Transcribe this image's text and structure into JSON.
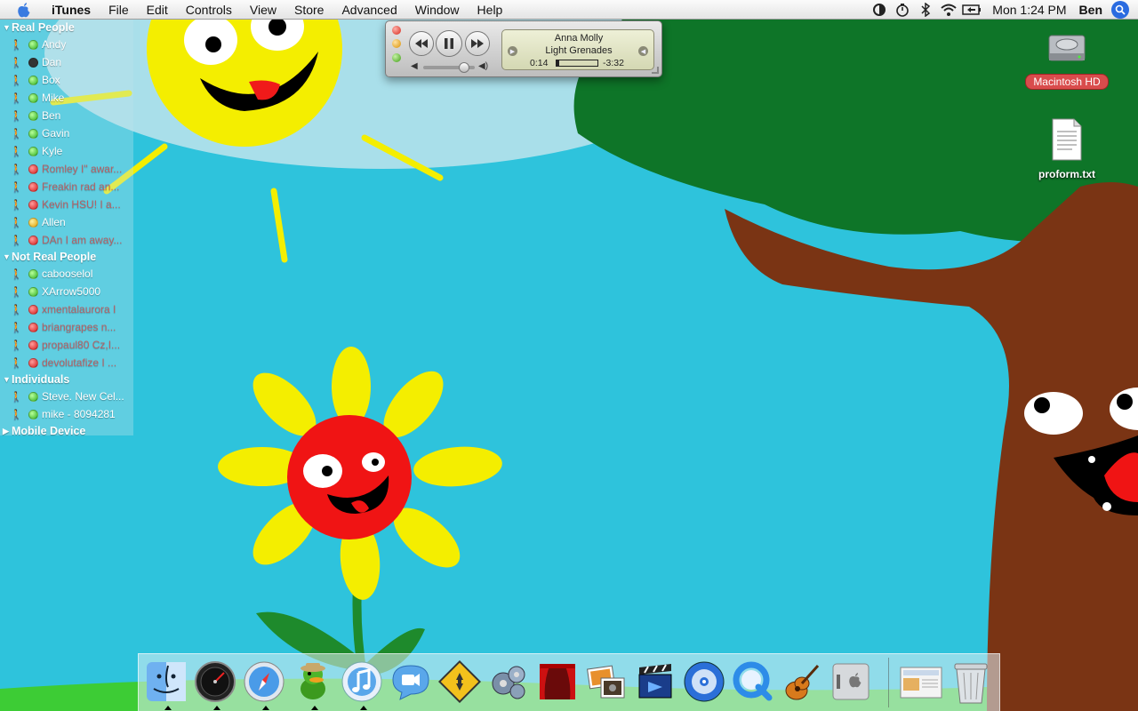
{
  "menubar": {
    "app_name": "iTunes",
    "items": [
      "File",
      "Edit",
      "Controls",
      "View",
      "Store",
      "Advanced",
      "Window",
      "Help"
    ],
    "clock": "Mon 1:24 PM",
    "user": "Ben",
    "tray_icons": [
      "sync-icon",
      "timer-icon",
      "bluetooth-icon",
      "wifi-icon",
      "battery-icon"
    ]
  },
  "buddy_list": {
    "groups": [
      {
        "name": "Real People",
        "expanded": true,
        "buddies": [
          {
            "name": "Andy",
            "status": "green"
          },
          {
            "name": "Dan",
            "status": "idle"
          },
          {
            "name": "Box",
            "status": "green"
          },
          {
            "name": "Mike",
            "status": "green"
          },
          {
            "name": "Ben",
            "status": "green"
          },
          {
            "name": "Gavin",
            "status": "green"
          },
          {
            "name": "Kyle",
            "status": "green"
          },
          {
            "name": "Romley  I\" awar...",
            "status": "red"
          },
          {
            "name": "Freakin rad  an...",
            "status": "red"
          },
          {
            "name": "Kevin HSU! I a...",
            "status": "red"
          },
          {
            "name": "Allen",
            "status": "yellow"
          },
          {
            "name": "DAn  I am away...",
            "status": "red"
          }
        ]
      },
      {
        "name": "Not Real People",
        "expanded": true,
        "buddies": [
          {
            "name": "cabooselol",
            "status": "green"
          },
          {
            "name": "XArrow5000",
            "status": "green"
          },
          {
            "name": "xmentalaurora  I",
            "status": "red"
          },
          {
            "name": "briangrapes  n...",
            "status": "red"
          },
          {
            "name": "propaul80  Cz,I...",
            "status": "red"
          },
          {
            "name": "devolutafize  I ...",
            "status": "red"
          }
        ]
      },
      {
        "name": "Individuals",
        "expanded": true,
        "buddies": [
          {
            "name": "Steve. New Cel...",
            "status": "green"
          },
          {
            "name": "mike - 8094281",
            "status": "green"
          }
        ]
      },
      {
        "name": "Mobile Device",
        "expanded": false,
        "buddies": []
      }
    ]
  },
  "itunes_mini": {
    "song": "Anna Molly",
    "artist": "Light Grenades",
    "elapsed": "0:14",
    "remaining": "-3:32",
    "progress_fraction": 0.06,
    "volume_fraction": 0.8
  },
  "desktop_icons": {
    "hd": "Macintosh HD",
    "file": "proform.txt"
  },
  "dock": {
    "apps": [
      "finder",
      "dashboard",
      "safari",
      "adium",
      "itunes",
      "ichat",
      "transmit",
      "system-preferences",
      "front-row",
      "photo-booth",
      "imovie",
      "dvd-player",
      "quicktime",
      "garageband",
      "boot-camp"
    ],
    "running": [
      "finder",
      "dashboard",
      "safari",
      "adium",
      "itunes"
    ],
    "right_items": [
      "downloads-stack",
      "trash"
    ]
  }
}
